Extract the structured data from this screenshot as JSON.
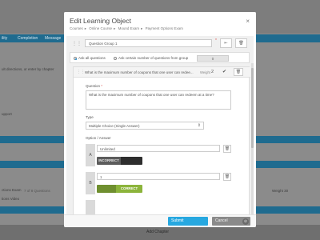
{
  "background": {
    "tabs": [
      "ility",
      "Completion",
      "Message"
    ],
    "lines": [
      "ult directions, or enter by chapter",
      "upport",
      "ctions Exam",
      "tions Video",
      "Weight 30"
    ],
    "dim_label": "7 of 8 Questions",
    "bottom_label": "Add Chapter"
  },
  "modal": {
    "title": "Edit Learning Object",
    "close_icon": "×",
    "breadcrumb": [
      "Courses",
      "Online Course",
      "Mound Exam",
      "Payment Options Exam"
    ],
    "group": {
      "value": "Question Group 1",
      "required": "*"
    },
    "selection": {
      "all_label": "Ask all questions",
      "random_label": "Ask certain number of questions from group",
      "random_count": "0"
    },
    "question": {
      "title": "What is the maximum number of coupons that one user can redee...",
      "weight_label": "Weight",
      "weight_value": "2",
      "question_label": "Question",
      "required": "*",
      "question_text": "What is the maximum number of coupons that one user can redeem at a time?",
      "type_label": "Type",
      "type_value": "Multiple Choice (Single Answer)",
      "options_label": "Option / Answer",
      "options": [
        {
          "letter": "A",
          "value": "Unlimited",
          "state": "INCORRECT"
        },
        {
          "letter": "B",
          "value": "1",
          "state": "CORRECT"
        }
      ]
    },
    "footer": {
      "submit": "Submit",
      "cancel": "Cancel"
    }
  },
  "colors": {
    "accent": "#27a8e0",
    "correct": "#8cb43b",
    "incorrect": "#5c5c5c",
    "required": "#d9534f"
  }
}
